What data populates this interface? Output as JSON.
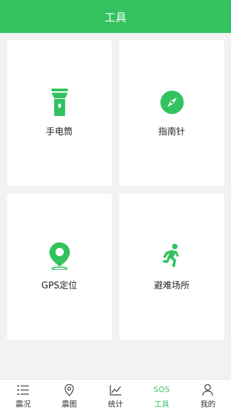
{
  "header": {
    "title": "工具"
  },
  "colors": {
    "accent": "#33c25f",
    "card_bg": "#ffffff",
    "page_bg": "#f2f2f2"
  },
  "tools": [
    {
      "label": "手电筒",
      "icon": "flashlight-icon"
    },
    {
      "label": "指南针",
      "icon": "compass-icon"
    },
    {
      "label": "GPS定位",
      "icon": "location-pin-icon"
    },
    {
      "label": "避难场所",
      "icon": "running-person-icon"
    }
  ],
  "tabbar": {
    "active": "tools",
    "items": [
      {
        "label": "震况",
        "icon": "list-icon"
      },
      {
        "label": "震图",
        "icon": "map-pin-icon"
      },
      {
        "label": "统计",
        "icon": "chart-icon"
      },
      {
        "label": "工具",
        "icon": "sos-icon",
        "icon_text": "SOS"
      },
      {
        "label": "我的",
        "icon": "user-icon"
      }
    ]
  }
}
